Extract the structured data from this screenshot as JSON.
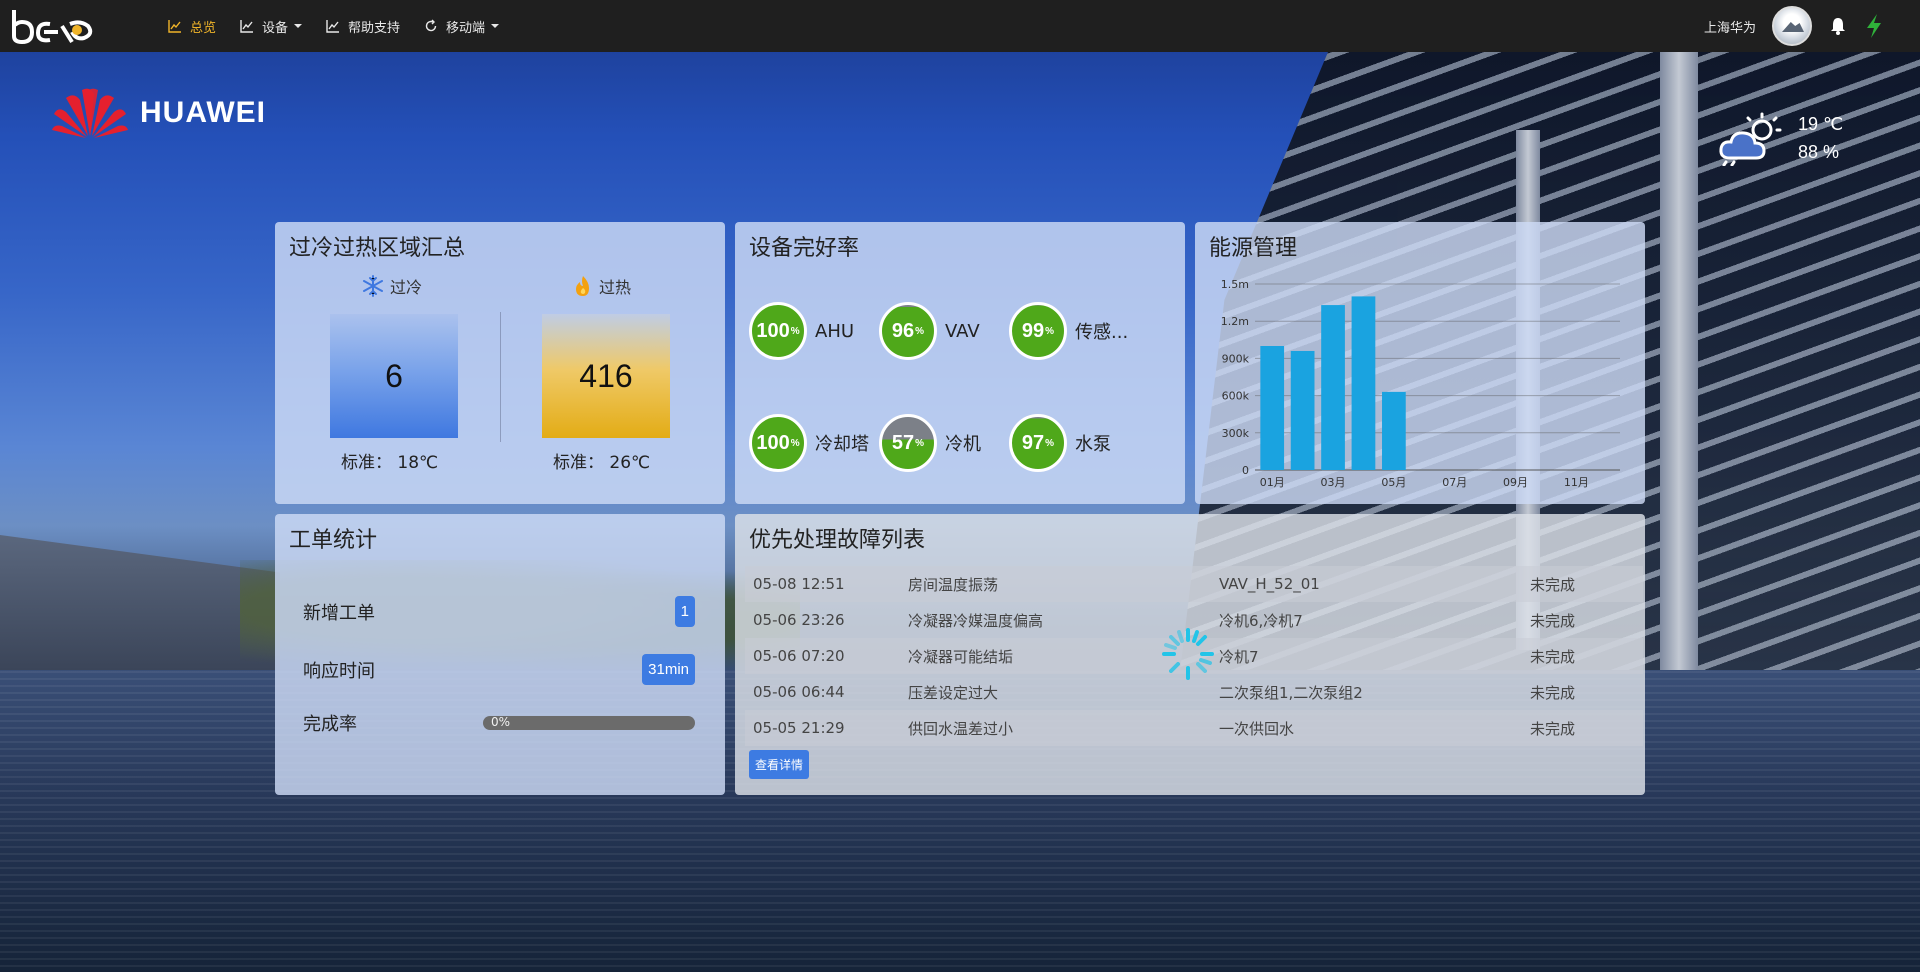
{
  "nav": {
    "logo": "bap",
    "items": [
      {
        "label": "总览",
        "icon": "line-chart-icon",
        "active": true,
        "dropdown": false
      },
      {
        "label": "设备",
        "icon": "line-chart-icon",
        "active": false,
        "dropdown": true
      },
      {
        "label": "帮助支持",
        "icon": "line-chart-icon",
        "active": false,
        "dropdown": false
      },
      {
        "label": "移动端",
        "icon": "refresh-icon",
        "active": false,
        "dropdown": true
      }
    ],
    "user": "上海华为",
    "accent": "#f0b429"
  },
  "brand": {
    "name": "HUAWEI"
  },
  "weather": {
    "temperature": "19 ℃",
    "humidity": "88 %",
    "icon": "cloud-sun-icon"
  },
  "overheat": {
    "title": "过冷过热区域汇总",
    "cold": {
      "label": "过冷",
      "icon": "snowflake-icon",
      "count": "6",
      "standard": "标准： 18℃",
      "color": "#3f78e0"
    },
    "hot": {
      "label": "过热",
      "icon": "flame-icon",
      "count": "416",
      "standard": "标准： 26℃",
      "color": "#e3ac15"
    }
  },
  "equipment": {
    "title": "设备完好率",
    "items": [
      {
        "label": "AHU",
        "rate": "100",
        "unit": "%",
        "fraction": 1.0
      },
      {
        "label": "VAV",
        "rate": "96",
        "unit": "%",
        "fraction": 0.96
      },
      {
        "label": "传感...",
        "rate": "99",
        "unit": "%",
        "fraction": 0.99
      },
      {
        "label": "冷却塔",
        "rate": "100",
        "unit": "%",
        "fraction": 1.0
      },
      {
        "label": "冷机",
        "rate": "57",
        "unit": "%",
        "fraction": 0.57
      },
      {
        "label": "水泵",
        "rate": "97",
        "unit": "%",
        "fraction": 0.97
      }
    ],
    "good_color": "#4fa81a",
    "bad_color": "#7c8088"
  },
  "energy": {
    "title": "能源管理",
    "chart_data": {
      "type": "bar",
      "x": [
        "01月",
        "02月",
        "03月",
        "04月",
        "05月",
        "06月",
        "07月",
        "08月",
        "09月",
        "10月",
        "11月",
        "12月"
      ],
      "tick_labels": [
        "01月",
        "03月",
        "05月",
        "07月",
        "09月",
        "11月"
      ],
      "values": [
        1000000,
        960000,
        1330000,
        1400000,
        630000,
        null,
        null,
        null,
        null,
        null,
        null,
        null
      ],
      "y_ticks": [
        0,
        300000,
        600000,
        900000,
        1200000,
        1500000
      ],
      "y_tick_labels": [
        "0",
        "300k",
        "600k",
        "900k",
        "1.2m",
        "1.5m"
      ],
      "ylim": [
        0,
        1500000
      ],
      "grid": true,
      "color": "#1aa3e0"
    }
  },
  "workorders": {
    "title": "工单统计",
    "new_label": "新增工单",
    "new_count": "1",
    "response_label": "响应时间",
    "response_value": "31min",
    "completion_label": "完成率",
    "completion_text": "0%",
    "completion_fraction": 0
  },
  "faults": {
    "title": "优先处理故障列表",
    "rows": [
      {
        "time": "05-08 12:51",
        "issue": "房间温度振荡",
        "device": "VAV_H_52_01",
        "status": "未完成"
      },
      {
        "time": "05-06 23:26",
        "issue": "冷凝器冷媒温度偏高",
        "device": "冷机6,冷机7",
        "status": "未完成"
      },
      {
        "time": "05-06 07:20",
        "issue": "冷凝器可能结垢",
        "device": "冷机7",
        "status": "未完成"
      },
      {
        "time": "05-06 06:44",
        "issue": "压差设定过大",
        "device": "二次泵组1,二次泵组2",
        "status": "未完成"
      },
      {
        "time": "05-05 21:29",
        "issue": "供回水温差过小",
        "device": "一次供回水",
        "status": "未完成"
      }
    ],
    "detail_button": "查看详情"
  }
}
